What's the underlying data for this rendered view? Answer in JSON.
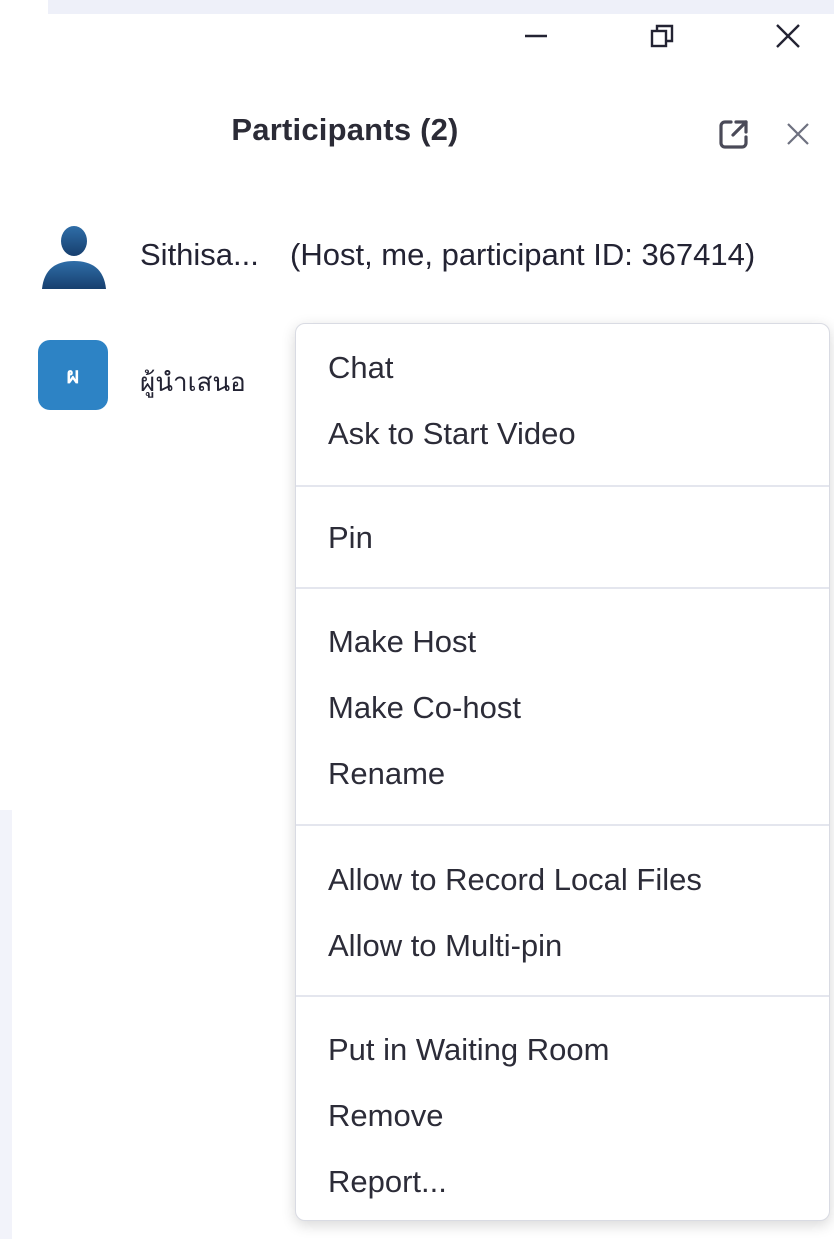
{
  "window_controls": {
    "minimize_icon": "minimize-icon",
    "restore_icon": "restore-icon",
    "close_icon": "close-icon"
  },
  "panel": {
    "title": "Participants (2)",
    "popout_icon": "popout-icon",
    "close_icon": "close-icon"
  },
  "participants": [
    {
      "name": "Sithisa...",
      "tag": "(Host, me, participant ID: 367414)",
      "avatar": "person-silhouette-icon"
    },
    {
      "name": "ผู้นำเสนอ",
      "avatar_initial": "ผ",
      "avatar_color": "#2d83c5"
    }
  ],
  "context_menu": {
    "items": [
      "Chat",
      "Ask to Start Video",
      "Pin",
      "Make Host",
      "Make Co-host",
      "Rename",
      "Allow to Record Local Files",
      "Allow to Multi-pin",
      "Put in Waiting Room",
      "Remove",
      "Report..."
    ]
  }
}
